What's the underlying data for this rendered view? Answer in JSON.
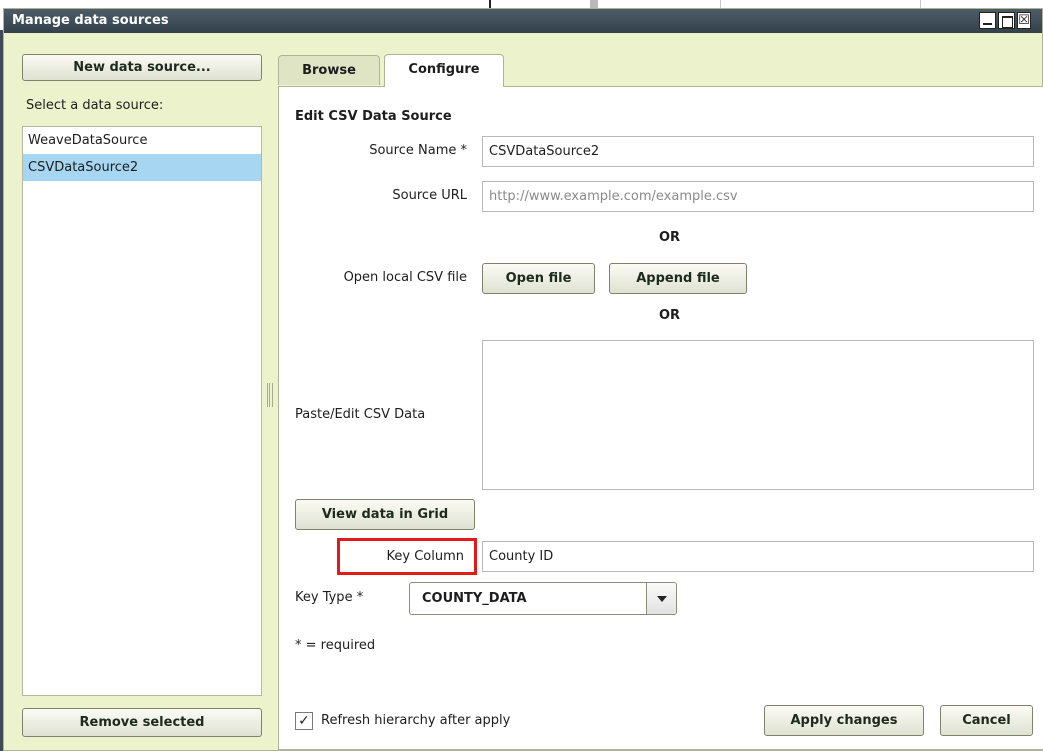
{
  "window": {
    "title": "Manage data sources",
    "controls": {
      "minimize_icon": "minimize-icon",
      "maximize_icon": "maximize-icon",
      "close_glyph": "☒"
    }
  },
  "left_panel": {
    "new_button": "New data source...",
    "select_label": "Select a data source:",
    "sources": [
      "WeaveDataSource",
      "CSVDataSource2"
    ],
    "selected_index": 1,
    "remove_button": "Remove selected"
  },
  "tabs": [
    {
      "label": "Browse",
      "active": false
    },
    {
      "label": "Configure",
      "active": true
    }
  ],
  "form": {
    "heading": "Edit CSV Data Source",
    "source_name_label": "Source Name *",
    "source_name_value": "CSVDataSource2",
    "source_url_label": "Source URL",
    "source_url_placeholder": "http://www.example.com/example.csv",
    "or_1": "OR",
    "open_local_label": "Open local CSV file",
    "open_file_button": "Open file",
    "append_file_button": "Append file",
    "or_2": "OR",
    "paste_label": "Paste/Edit CSV Data",
    "paste_value": "",
    "view_grid_button": "View data in Grid",
    "key_column_label": "Key Column",
    "key_column_value": "County ID",
    "key_type_label": "Key Type *",
    "key_type_value": "COUNTY_DATA",
    "required_note": "* = required",
    "refresh_checkbox_label": "Refresh hierarchy after apply",
    "refresh_checked": true,
    "check_glyph": "✓",
    "apply_button": "Apply changes",
    "cancel_button": "Cancel"
  },
  "colors": {
    "titlebar": "#3d4b56",
    "window_bg": "#ecf3cc",
    "selected_row": "#a6d6f2",
    "highlight_box": "#e11a1a"
  }
}
